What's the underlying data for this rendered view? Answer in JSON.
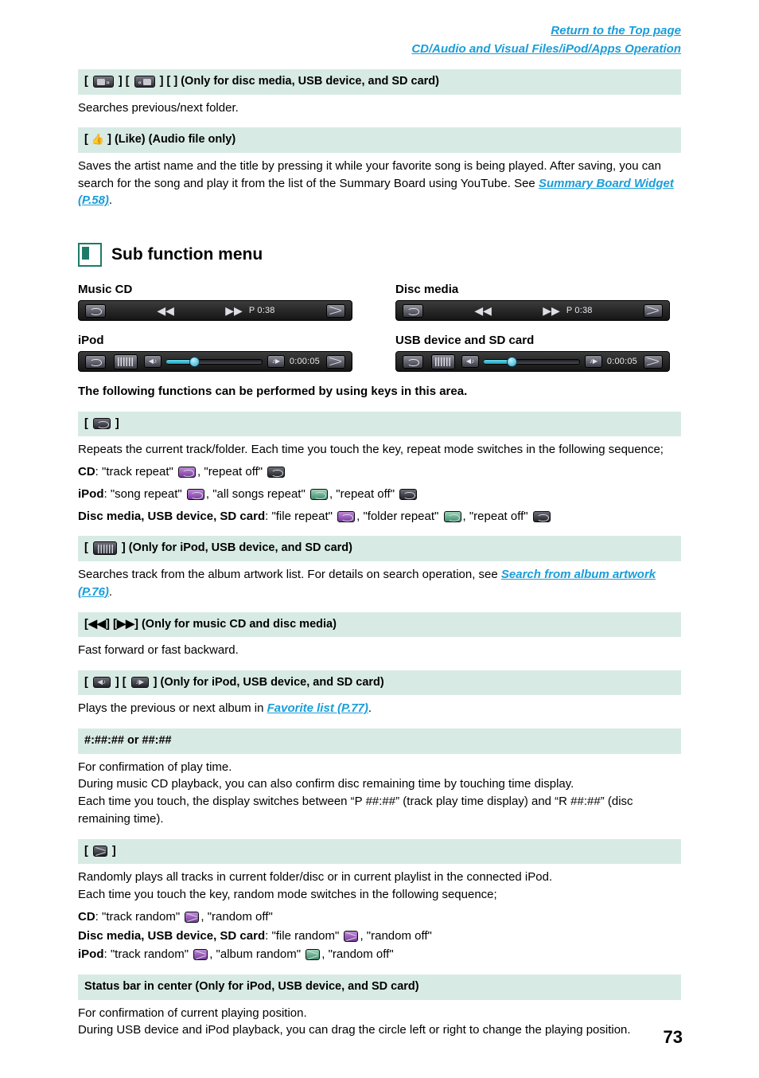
{
  "header": {
    "link_top": "Return to the Top page",
    "link_section": "CD/Audio and Visual Files/iPod/Apps Operation"
  },
  "top_sections": [
    {
      "bar": "] [ ] (Only for disc media, USB device, and SD card)",
      "bar_prefix": "[",
      "bar_mid": "] [",
      "body": "Searches previous/next folder."
    }
  ],
  "like_section": {
    "bar_prefix": "[",
    "bar_suffix": "] (Like) (Audio file only)",
    "body_1": "Saves the artist name and the title by pressing it while your favorite song is being played. After saving, you can search for the song and play it from the list of the Summary Board using YouTube. See ",
    "link": "Summary Board Widget (P.58)",
    "body_2": "."
  },
  "section": {
    "title": "Sub function menu",
    "labels": {
      "music_cd": "Music CD",
      "disc_media": "Disc media",
      "ipod": "iPod",
      "usb_sd": "USB device and SD card"
    },
    "bars": {
      "cd_time": "P 0:38",
      "ipod_time": "0:00:05"
    },
    "intro": "The following functions can be performed by using keys in this area."
  },
  "repeat_section": {
    "bar_prefix": "[",
    "bar_suffix": "]",
    "body_1": "Repeats the current track/folder. Each time you touch the key, repeat mode switches in the following sequence;",
    "cd_label": "CD",
    "cd_line": ": \"track repeat\"    , \"repeat off\"",
    "ipod_label": "iPod",
    "ipod_line": ": \"song repeat\"    , \"all songs repeat\"    , \"repeat off\"",
    "disc_label": "Disc media, USB device, SD card",
    "disc_line": ": \"file repeat\"    , \"folder repeat\"    , \"repeat off\""
  },
  "artwork_section": {
    "bar_prefix": "[",
    "bar_suffix": "] (Only for iPod, USB device, and SD card)",
    "body_1": "Searches track from the album artwork list. For details on search operation, see ",
    "link": "Search from album artwork (P.76)",
    "body_2": "."
  },
  "ff_section": {
    "bar": "[◀◀] [▶▶] (Only for music CD and disc media)",
    "body": "Fast forward or fast backward."
  },
  "album_section": {
    "bar_prefix": "[",
    "bar_mid": "] [",
    "bar_suffix": "] (Only for iPod, USB device, and SD card)",
    "body_1": "Plays the previous or next album in ",
    "link": "Favorite list (P.77)",
    "body_2": "."
  },
  "time_section": {
    "bar": "#:##:## or ##:##",
    "body_1": "For confirmation of play time.",
    "body_2": "During music CD playback, you can also confirm disc remaining time by touching time display.",
    "body_3": "Each time you touch, the display switches between “P ##:##” (track play time display) and “R ##:##” (disc remaining time)."
  },
  "random_section": {
    "bar_prefix": "[",
    "bar_suffix": "]",
    "body_1": "Randomly plays all tracks in current folder/disc or in current playlist in the connected iPod.",
    "body_2": "Each time you touch the key, random mode switches in the following sequence;",
    "cd_label": "CD",
    "cd_line": ": \"track random\"    , \"random off\"",
    "disc_label": "Disc media, USB device, SD card",
    "disc_line": ": \"file random\"    , \"random off\"",
    "ipod_label": "iPod",
    "ipod_line": ": \"track random\"    , \"album random\"    , \"random off\""
  },
  "status_section": {
    "bar": "Status bar in center (Only for iPod, USB device, and SD card)",
    "body_1": "For confirmation of current playing position.",
    "body_2": "During USB device and iPod playback, you can drag the circle left or right to change the playing position."
  },
  "page_number": "73"
}
